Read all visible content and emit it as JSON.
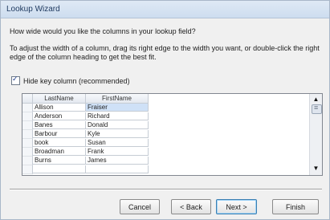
{
  "window": {
    "title": "Lookup Wizard"
  },
  "question": "How wide would you like the columns in your lookup field?",
  "instructions": "To adjust the width of a column, drag its right edge to the width you want, or double-click the right edge of the column heading to get the best fit.",
  "hide_key": {
    "label": "Hide key column (recommended)",
    "checked": true
  },
  "grid": {
    "columns": [
      "LastName",
      "FirstName"
    ],
    "rows": [
      [
        "Allison",
        "Fraiser"
      ],
      [
        "Anderson",
        "Richard"
      ],
      [
        "Banes",
        "Donald"
      ],
      [
        "Barbour",
        "Kyle"
      ],
      [
        "book",
        "Susan"
      ],
      [
        "Broadman",
        "Frank"
      ],
      [
        "Burns",
        "James"
      ]
    ]
  },
  "buttons": {
    "cancel": "Cancel",
    "back": "< Back",
    "next": "Next >",
    "finish": "Finish"
  },
  "icons": {
    "scroll_up": "▲",
    "scroll_down": "▼"
  }
}
